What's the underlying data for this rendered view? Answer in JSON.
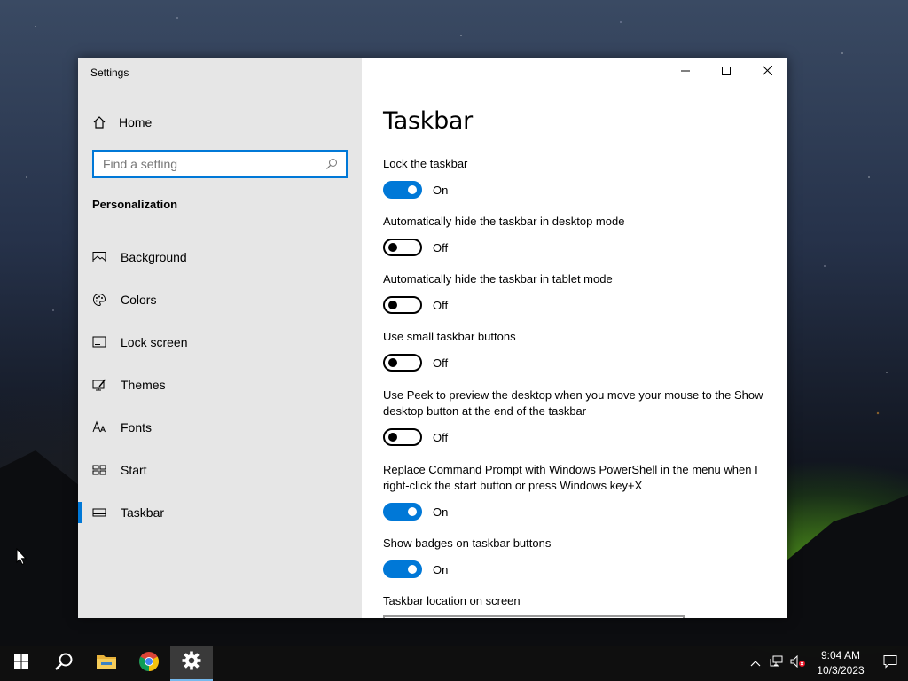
{
  "window": {
    "app_title": "Settings",
    "controls": {
      "minimize": "minimize",
      "maximize": "maximize",
      "close": "close"
    }
  },
  "sidebar": {
    "home_label": "Home",
    "search_placeholder": "Find a setting",
    "section_title": "Personalization",
    "items": [
      {
        "label": "Background",
        "icon": "picture-icon"
      },
      {
        "label": "Colors",
        "icon": "palette-icon"
      },
      {
        "label": "Lock screen",
        "icon": "lock-screen-icon"
      },
      {
        "label": "Themes",
        "icon": "themes-icon"
      },
      {
        "label": "Fonts",
        "icon": "fonts-icon"
      },
      {
        "label": "Start",
        "icon": "start-icon"
      },
      {
        "label": "Taskbar",
        "icon": "taskbar-icon",
        "active": true
      }
    ]
  },
  "content": {
    "page_title": "Taskbar",
    "settings": [
      {
        "label": "Lock the taskbar",
        "state": "On"
      },
      {
        "label": "Automatically hide the taskbar in desktop mode",
        "state": "Off"
      },
      {
        "label": "Automatically hide the taskbar in tablet mode",
        "state": "Off"
      },
      {
        "label": "Use small taskbar buttons",
        "state": "Off"
      },
      {
        "label": "Use Peek to preview the desktop when you move your mouse to the Show desktop button at the end of the taskbar",
        "state": "Off"
      },
      {
        "label": "Replace Command Prompt with Windows PowerShell in the menu when I right-click the start button or press Windows key+X",
        "state": "On"
      },
      {
        "label": "Show badges on taskbar buttons",
        "state": "On"
      },
      {
        "label": "Taskbar location on screen"
      }
    ]
  },
  "taskbar": {
    "clock": {
      "time": "9:04 AM",
      "date": "10/3/2023"
    },
    "apps": [
      "start-icon",
      "search-icon",
      "file-explorer-icon",
      "chrome-icon",
      "settings-gear-icon"
    ]
  },
  "colors": {
    "accent": "#0078d7",
    "sidebar_bg": "#e6e6e6",
    "taskbar_bg": "#101010"
  }
}
